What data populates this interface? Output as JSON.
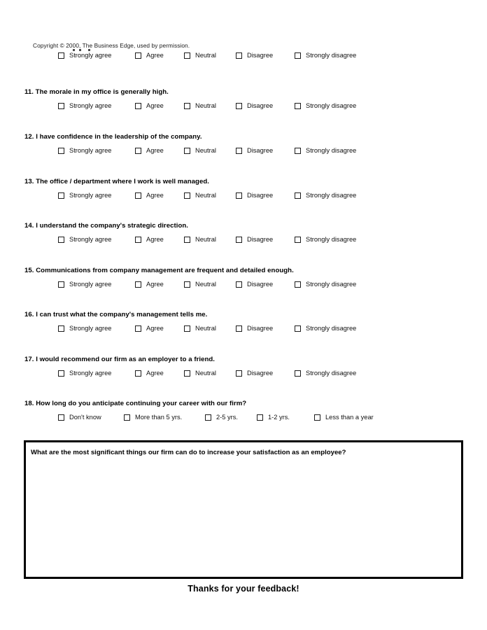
{
  "document": {
    "copyright": "Copyright © 2000, The Business Edge, used by permission.",
    "footer_text": "Thanks for your feedback!"
  },
  "scale_options": [
    "Strongly agree",
    "Agree",
    "Neutral",
    "Disagree",
    "Strongly disagree"
  ],
  "questions": [
    {
      "number": "",
      "text": "",
      "partial_top_row": true,
      "options": [
        "Strongly agree",
        "Agree",
        "Neutral",
        "Disagree",
        "Strongly disagree"
      ]
    },
    {
      "number": "11.",
      "text": "11. The morale in my office is generally high.",
      "options": [
        "Strongly agree",
        "Agree",
        "Neutral",
        "Disagree",
        "Strongly disagree"
      ]
    },
    {
      "number": "12.",
      "text": "12. I have confidence in the leadership of the company.",
      "options": [
        "Strongly agree",
        "Agree",
        "Neutral",
        "Disagree",
        "Strongly disagree"
      ]
    },
    {
      "number": "13.",
      "text": "13. The office / department where I work is well managed.",
      "options": [
        "Strongly agree",
        "Agree",
        "Neutral",
        "Disagree",
        "Strongly disagree"
      ]
    },
    {
      "number": "14.",
      "text": "14. I understand the company's strategic direction.",
      "options": [
        "Strongly agree",
        "Agree",
        "Neutral",
        "Disagree",
        "Strongly disagree"
      ]
    },
    {
      "number": "15.",
      "text": "15. Communications from company management are frequent and detailed enough.",
      "options": [
        "Strongly agree",
        "Agree",
        "Neutral",
        "Disagree",
        "Strongly disagree"
      ]
    },
    {
      "number": "16.",
      "text": "16. I can trust what the company's management tells me.",
      "options": [
        "Strongly agree",
        "Agree",
        "Neutral",
        "Disagree",
        "Strongly disagree"
      ]
    },
    {
      "number": "17.",
      "text": "17.  I would recommend our firm as an employer to a friend.",
      "options": [
        "Strongly agree",
        "Agree",
        "Neutral",
        "Disagree",
        "Strongly disagree"
      ]
    },
    {
      "number": "18.",
      "text": "18. How long do you anticipate continuing your career with our firm?",
      "options": [
        "Don't know",
        "More than 5 yrs.",
        "2-5 yrs.",
        "1-2 yrs.",
        "Less than a year"
      ]
    }
  ],
  "open_response": {
    "prompt": "What are the most significant things our firm can do to increase your satisfaction as an employee?",
    "value": ""
  }
}
